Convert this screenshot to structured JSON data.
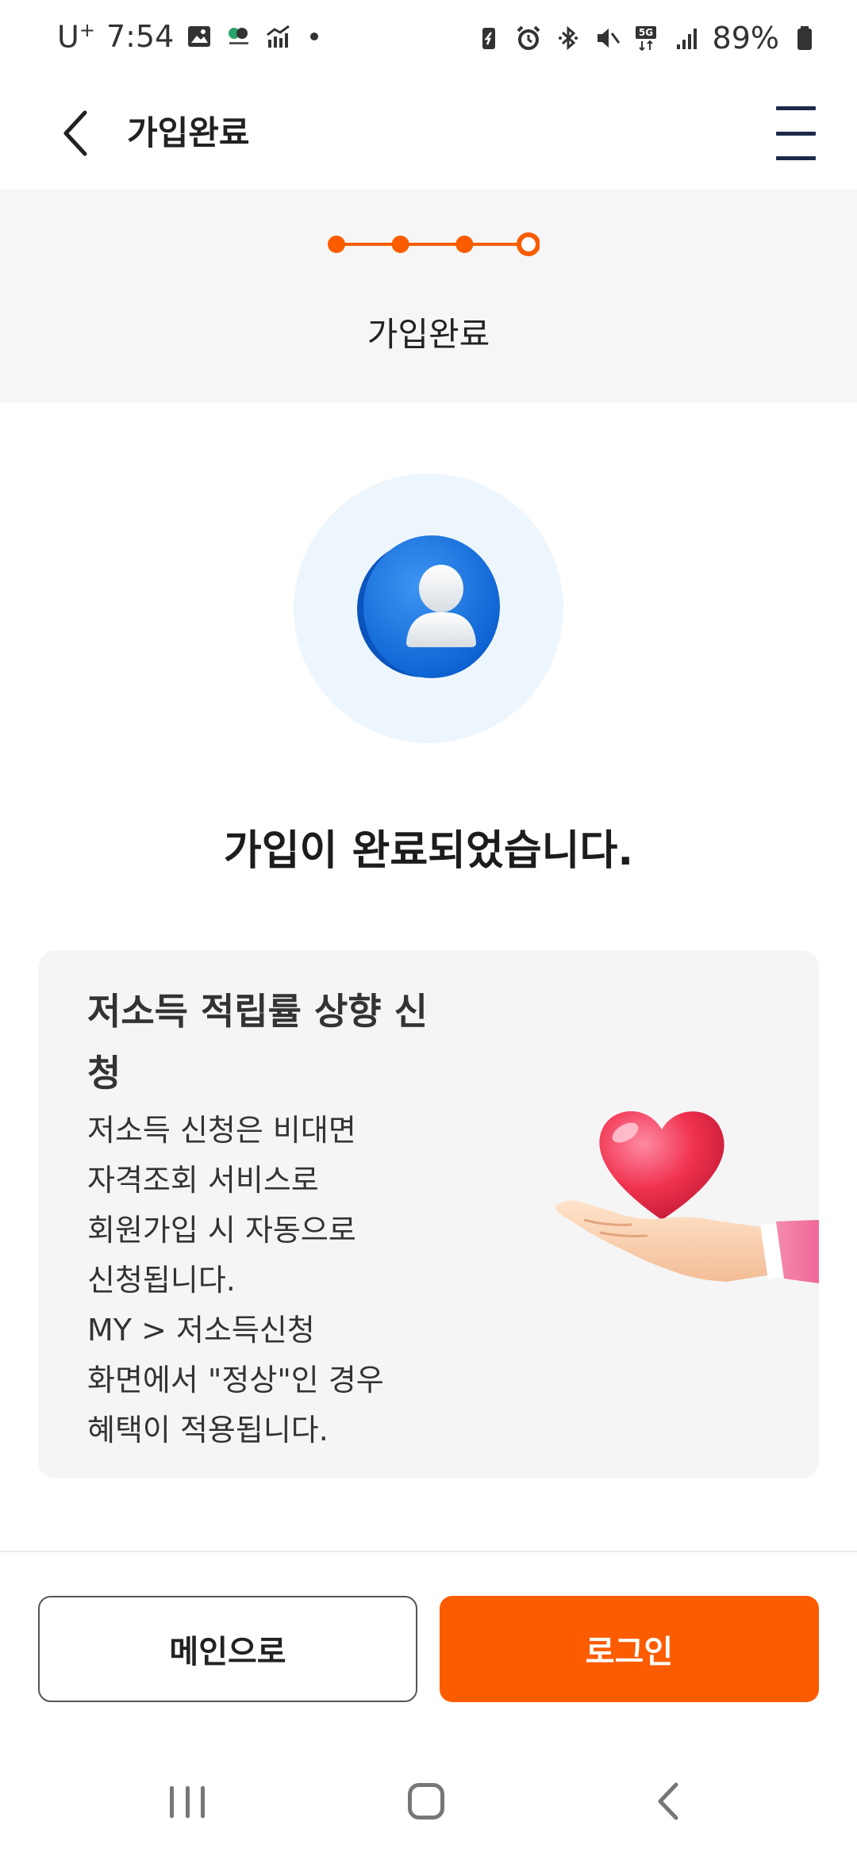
{
  "status_bar": {
    "carrier": "U",
    "carrier_sup": "+",
    "time": "7:54",
    "battery": "89%",
    "network": "5G"
  },
  "header": {
    "title": "가입완료"
  },
  "progress": {
    "total_steps": 4,
    "current_step": 4,
    "step_title": "가입완료",
    "accent_color": "#fb5c00"
  },
  "hero": {
    "message": "가입이 완료되었습니다."
  },
  "card": {
    "title": "저소득 적립률 상향 신청",
    "body_lines": [
      "저소득 신청은 비대면",
      "자격조회 서비스로",
      "회원가입 시 자동으로",
      "신청됩니다.",
      "MY > 저소득신청",
      "화면에서 \"정상\"인 경우",
      "혜택이 적용됩니다."
    ]
  },
  "buttons": {
    "main_label": "메인으로",
    "login_label": "로그인"
  },
  "icons": {
    "back": "chevron-left-icon",
    "menu": "hamburger-menu-icon",
    "user": "user-avatar-icon",
    "illustration": "heart-in-hand-icon"
  }
}
